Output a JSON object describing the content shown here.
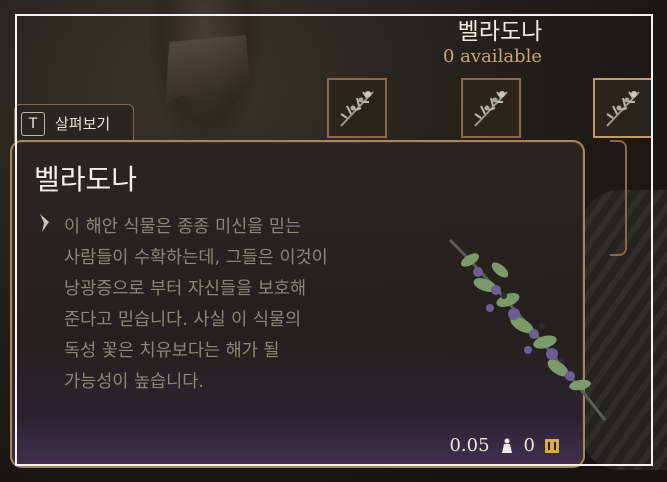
{
  "item": {
    "name": "벨라도나",
    "available": "0 available"
  },
  "slots": [
    {
      "icon": "belladonna-icon",
      "selected": false
    },
    {
      "icon": "belladonna-icon",
      "selected": false
    },
    {
      "icon": "belladonna-icon",
      "selected": true
    }
  ],
  "tab": {
    "key": "T",
    "label": "살펴보기"
  },
  "tooltip": {
    "title": "벨라도나",
    "description": "이 해안 식물은 종종 미신을 믿는\n사람들이 수확하는데, 그들은 이것이\n낭광증으로 부터 자신들을 보호해\n준다고 믿습니다. 사실 이 식물의\n독성 꽃은 치유보다는 해가 될\n가능성이 높습니다.",
    "weight": "0.05",
    "value": "0",
    "weight_icon": "weight-icon",
    "value_icon": "gold-coin-icon"
  },
  "colors": {
    "border_gold": "#a8855a",
    "accent_text": "#c9a676",
    "description_text": "#8c8578"
  }
}
